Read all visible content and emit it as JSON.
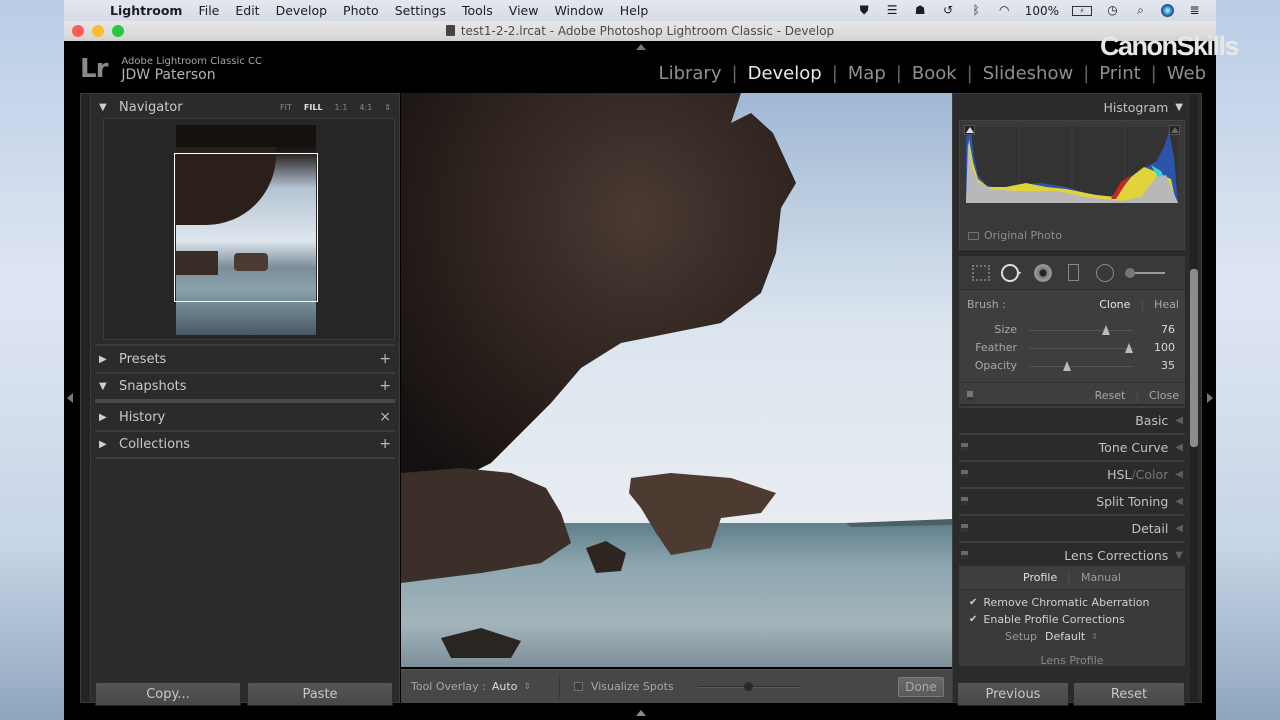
{
  "menubar": {
    "app_name": "Lightroom",
    "items": [
      "File",
      "Edit",
      "Develop",
      "Photo",
      "Settings",
      "Tools",
      "View",
      "Window",
      "Help"
    ],
    "battery": "100%",
    "status_icons": [
      "shield-icon",
      "tray-icon",
      "dropbox-icon",
      "time-machine-icon",
      "bluetooth-icon",
      "wifi-icon",
      "battery-icon",
      "clock-icon",
      "spotlight-icon",
      "siri-icon",
      "notification-center-icon"
    ]
  },
  "window": {
    "title": "test1-2-2.lrcat - Adobe Photoshop Lightroom Classic - Develop"
  },
  "identity": {
    "logo": "Lr",
    "product": "Adobe Lightroom Classic CC",
    "user": "JDW Paterson"
  },
  "watermark": "CanonSkills",
  "modules": {
    "items": [
      "Library",
      "Develop",
      "Map",
      "Book",
      "Slideshow",
      "Print",
      "Web"
    ],
    "active": "Develop"
  },
  "left_panel": {
    "navigator": {
      "title": "Navigator",
      "zoom_options": [
        "FIT",
        "FILL",
        "1:1",
        "4:1"
      ],
      "zoom_active": "FILL"
    },
    "sections": [
      {
        "title": "Presets",
        "state": "collapsed",
        "action": "+"
      },
      {
        "title": "Snapshots",
        "state": "expanded",
        "action": "+"
      },
      {
        "title": "History",
        "state": "collapsed",
        "action": "×"
      },
      {
        "title": "Collections",
        "state": "collapsed",
        "action": "+"
      }
    ],
    "copy_label": "Copy...",
    "paste_label": "Paste"
  },
  "toolbar": {
    "tool_overlay_label": "Tool Overlay :",
    "tool_overlay_value": "Auto",
    "visualize_spots_label": "Visualize Spots",
    "visualize_spots_checked": false,
    "visualize_threshold": 0.5,
    "done_label": "Done"
  },
  "right_panel": {
    "histogram": {
      "title": "Histogram",
      "original_photo_label": "Original Photo"
    },
    "spot_removal": {
      "brush_label": "Brush :",
      "clone_label": "Clone",
      "heal_label": "Heal",
      "active_brush": "Clone",
      "sliders": [
        {
          "label": "Size",
          "value": 76,
          "fraction": 0.76
        },
        {
          "label": "Feather",
          "value": 100,
          "fraction": 1.0
        },
        {
          "label": "Opacity",
          "value": 35,
          "fraction": 0.35
        }
      ],
      "reset_label": "Reset",
      "close_label": "Close"
    },
    "panels": [
      {
        "title": "Basic",
        "state": "collapsed",
        "switch": false
      },
      {
        "title": "Tone Curve",
        "state": "collapsed",
        "switch": true
      },
      {
        "title": "HSL",
        "title_suffix": "Color",
        "state": "collapsed",
        "switch": true
      },
      {
        "title": "Split Toning",
        "state": "collapsed",
        "switch": true
      },
      {
        "title": "Detail",
        "state": "collapsed",
        "switch": true
      },
      {
        "title": "Lens Corrections",
        "state": "expanded",
        "switch": true
      }
    ],
    "lens_corrections": {
      "tabs": [
        "Profile",
        "Manual"
      ],
      "active_tab": "Profile",
      "remove_ca_label": "Remove Chromatic Aberration",
      "remove_ca_checked": true,
      "enable_profile_label": "Enable Profile Corrections",
      "enable_profile_checked": true,
      "setup_label": "Setup",
      "setup_value": "Default",
      "lens_profile_label": "Lens Profile"
    },
    "previous_label": "Previous",
    "reset_label": "Reset"
  },
  "colors": {
    "panel_bg": "#2b2b2b",
    "active_module": "#e8e8e8",
    "inactive_module": "#8f8f8f"
  }
}
